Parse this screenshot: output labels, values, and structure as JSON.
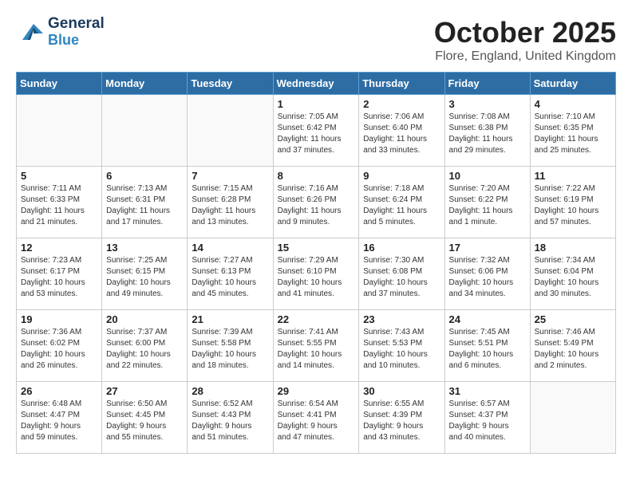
{
  "header": {
    "logo_general": "General",
    "logo_blue": "Blue",
    "month": "October 2025",
    "location": "Flore, England, United Kingdom"
  },
  "weekdays": [
    "Sunday",
    "Monday",
    "Tuesday",
    "Wednesday",
    "Thursday",
    "Friday",
    "Saturday"
  ],
  "weeks": [
    [
      {
        "day": "",
        "info": ""
      },
      {
        "day": "",
        "info": ""
      },
      {
        "day": "",
        "info": ""
      },
      {
        "day": "1",
        "info": "Sunrise: 7:05 AM\nSunset: 6:42 PM\nDaylight: 11 hours\nand 37 minutes."
      },
      {
        "day": "2",
        "info": "Sunrise: 7:06 AM\nSunset: 6:40 PM\nDaylight: 11 hours\nand 33 minutes."
      },
      {
        "day": "3",
        "info": "Sunrise: 7:08 AM\nSunset: 6:38 PM\nDaylight: 11 hours\nand 29 minutes."
      },
      {
        "day": "4",
        "info": "Sunrise: 7:10 AM\nSunset: 6:35 PM\nDaylight: 11 hours\nand 25 minutes."
      }
    ],
    [
      {
        "day": "5",
        "info": "Sunrise: 7:11 AM\nSunset: 6:33 PM\nDaylight: 11 hours\nand 21 minutes."
      },
      {
        "day": "6",
        "info": "Sunrise: 7:13 AM\nSunset: 6:31 PM\nDaylight: 11 hours\nand 17 minutes."
      },
      {
        "day": "7",
        "info": "Sunrise: 7:15 AM\nSunset: 6:28 PM\nDaylight: 11 hours\nand 13 minutes."
      },
      {
        "day": "8",
        "info": "Sunrise: 7:16 AM\nSunset: 6:26 PM\nDaylight: 11 hours\nand 9 minutes."
      },
      {
        "day": "9",
        "info": "Sunrise: 7:18 AM\nSunset: 6:24 PM\nDaylight: 11 hours\nand 5 minutes."
      },
      {
        "day": "10",
        "info": "Sunrise: 7:20 AM\nSunset: 6:22 PM\nDaylight: 11 hours\nand 1 minute."
      },
      {
        "day": "11",
        "info": "Sunrise: 7:22 AM\nSunset: 6:19 PM\nDaylight: 10 hours\nand 57 minutes."
      }
    ],
    [
      {
        "day": "12",
        "info": "Sunrise: 7:23 AM\nSunset: 6:17 PM\nDaylight: 10 hours\nand 53 minutes."
      },
      {
        "day": "13",
        "info": "Sunrise: 7:25 AM\nSunset: 6:15 PM\nDaylight: 10 hours\nand 49 minutes."
      },
      {
        "day": "14",
        "info": "Sunrise: 7:27 AM\nSunset: 6:13 PM\nDaylight: 10 hours\nand 45 minutes."
      },
      {
        "day": "15",
        "info": "Sunrise: 7:29 AM\nSunset: 6:10 PM\nDaylight: 10 hours\nand 41 minutes."
      },
      {
        "day": "16",
        "info": "Sunrise: 7:30 AM\nSunset: 6:08 PM\nDaylight: 10 hours\nand 37 minutes."
      },
      {
        "day": "17",
        "info": "Sunrise: 7:32 AM\nSunset: 6:06 PM\nDaylight: 10 hours\nand 34 minutes."
      },
      {
        "day": "18",
        "info": "Sunrise: 7:34 AM\nSunset: 6:04 PM\nDaylight: 10 hours\nand 30 minutes."
      }
    ],
    [
      {
        "day": "19",
        "info": "Sunrise: 7:36 AM\nSunset: 6:02 PM\nDaylight: 10 hours\nand 26 minutes."
      },
      {
        "day": "20",
        "info": "Sunrise: 7:37 AM\nSunset: 6:00 PM\nDaylight: 10 hours\nand 22 minutes."
      },
      {
        "day": "21",
        "info": "Sunrise: 7:39 AM\nSunset: 5:58 PM\nDaylight: 10 hours\nand 18 minutes."
      },
      {
        "day": "22",
        "info": "Sunrise: 7:41 AM\nSunset: 5:55 PM\nDaylight: 10 hours\nand 14 minutes."
      },
      {
        "day": "23",
        "info": "Sunrise: 7:43 AM\nSunset: 5:53 PM\nDaylight: 10 hours\nand 10 minutes."
      },
      {
        "day": "24",
        "info": "Sunrise: 7:45 AM\nSunset: 5:51 PM\nDaylight: 10 hours\nand 6 minutes."
      },
      {
        "day": "25",
        "info": "Sunrise: 7:46 AM\nSunset: 5:49 PM\nDaylight: 10 hours\nand 2 minutes."
      }
    ],
    [
      {
        "day": "26",
        "info": "Sunrise: 6:48 AM\nSunset: 4:47 PM\nDaylight: 9 hours\nand 59 minutes."
      },
      {
        "day": "27",
        "info": "Sunrise: 6:50 AM\nSunset: 4:45 PM\nDaylight: 9 hours\nand 55 minutes."
      },
      {
        "day": "28",
        "info": "Sunrise: 6:52 AM\nSunset: 4:43 PM\nDaylight: 9 hours\nand 51 minutes."
      },
      {
        "day": "29",
        "info": "Sunrise: 6:54 AM\nSunset: 4:41 PM\nDaylight: 9 hours\nand 47 minutes."
      },
      {
        "day": "30",
        "info": "Sunrise: 6:55 AM\nSunset: 4:39 PM\nDaylight: 9 hours\nand 43 minutes."
      },
      {
        "day": "31",
        "info": "Sunrise: 6:57 AM\nSunset: 4:37 PM\nDaylight: 9 hours\nand 40 minutes."
      },
      {
        "day": "",
        "info": ""
      }
    ]
  ]
}
